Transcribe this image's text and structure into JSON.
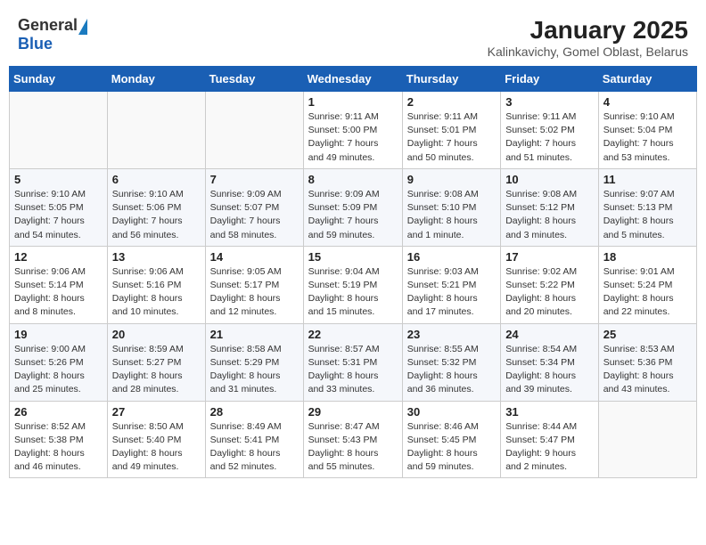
{
  "header": {
    "logo_general": "General",
    "logo_blue": "Blue",
    "title": "January 2025",
    "subtitle": "Kalinkavichy, Gomel Oblast, Belarus"
  },
  "weekdays": [
    "Sunday",
    "Monday",
    "Tuesday",
    "Wednesday",
    "Thursday",
    "Friday",
    "Saturday"
  ],
  "weeks": [
    [
      {
        "day": "",
        "info": ""
      },
      {
        "day": "",
        "info": ""
      },
      {
        "day": "",
        "info": ""
      },
      {
        "day": "1",
        "info": "Sunrise: 9:11 AM\nSunset: 5:00 PM\nDaylight: 7 hours\nand 49 minutes."
      },
      {
        "day": "2",
        "info": "Sunrise: 9:11 AM\nSunset: 5:01 PM\nDaylight: 7 hours\nand 50 minutes."
      },
      {
        "day": "3",
        "info": "Sunrise: 9:11 AM\nSunset: 5:02 PM\nDaylight: 7 hours\nand 51 minutes."
      },
      {
        "day": "4",
        "info": "Sunrise: 9:10 AM\nSunset: 5:04 PM\nDaylight: 7 hours\nand 53 minutes."
      }
    ],
    [
      {
        "day": "5",
        "info": "Sunrise: 9:10 AM\nSunset: 5:05 PM\nDaylight: 7 hours\nand 54 minutes."
      },
      {
        "day": "6",
        "info": "Sunrise: 9:10 AM\nSunset: 5:06 PM\nDaylight: 7 hours\nand 56 minutes."
      },
      {
        "day": "7",
        "info": "Sunrise: 9:09 AM\nSunset: 5:07 PM\nDaylight: 7 hours\nand 58 minutes."
      },
      {
        "day": "8",
        "info": "Sunrise: 9:09 AM\nSunset: 5:09 PM\nDaylight: 7 hours\nand 59 minutes."
      },
      {
        "day": "9",
        "info": "Sunrise: 9:08 AM\nSunset: 5:10 PM\nDaylight: 8 hours\nand 1 minute."
      },
      {
        "day": "10",
        "info": "Sunrise: 9:08 AM\nSunset: 5:12 PM\nDaylight: 8 hours\nand 3 minutes."
      },
      {
        "day": "11",
        "info": "Sunrise: 9:07 AM\nSunset: 5:13 PM\nDaylight: 8 hours\nand 5 minutes."
      }
    ],
    [
      {
        "day": "12",
        "info": "Sunrise: 9:06 AM\nSunset: 5:14 PM\nDaylight: 8 hours\nand 8 minutes."
      },
      {
        "day": "13",
        "info": "Sunrise: 9:06 AM\nSunset: 5:16 PM\nDaylight: 8 hours\nand 10 minutes."
      },
      {
        "day": "14",
        "info": "Sunrise: 9:05 AM\nSunset: 5:17 PM\nDaylight: 8 hours\nand 12 minutes."
      },
      {
        "day": "15",
        "info": "Sunrise: 9:04 AM\nSunset: 5:19 PM\nDaylight: 8 hours\nand 15 minutes."
      },
      {
        "day": "16",
        "info": "Sunrise: 9:03 AM\nSunset: 5:21 PM\nDaylight: 8 hours\nand 17 minutes."
      },
      {
        "day": "17",
        "info": "Sunrise: 9:02 AM\nSunset: 5:22 PM\nDaylight: 8 hours\nand 20 minutes."
      },
      {
        "day": "18",
        "info": "Sunrise: 9:01 AM\nSunset: 5:24 PM\nDaylight: 8 hours\nand 22 minutes."
      }
    ],
    [
      {
        "day": "19",
        "info": "Sunrise: 9:00 AM\nSunset: 5:26 PM\nDaylight: 8 hours\nand 25 minutes."
      },
      {
        "day": "20",
        "info": "Sunrise: 8:59 AM\nSunset: 5:27 PM\nDaylight: 8 hours\nand 28 minutes."
      },
      {
        "day": "21",
        "info": "Sunrise: 8:58 AM\nSunset: 5:29 PM\nDaylight: 8 hours\nand 31 minutes."
      },
      {
        "day": "22",
        "info": "Sunrise: 8:57 AM\nSunset: 5:31 PM\nDaylight: 8 hours\nand 33 minutes."
      },
      {
        "day": "23",
        "info": "Sunrise: 8:55 AM\nSunset: 5:32 PM\nDaylight: 8 hours\nand 36 minutes."
      },
      {
        "day": "24",
        "info": "Sunrise: 8:54 AM\nSunset: 5:34 PM\nDaylight: 8 hours\nand 39 minutes."
      },
      {
        "day": "25",
        "info": "Sunrise: 8:53 AM\nSunset: 5:36 PM\nDaylight: 8 hours\nand 43 minutes."
      }
    ],
    [
      {
        "day": "26",
        "info": "Sunrise: 8:52 AM\nSunset: 5:38 PM\nDaylight: 8 hours\nand 46 minutes."
      },
      {
        "day": "27",
        "info": "Sunrise: 8:50 AM\nSunset: 5:40 PM\nDaylight: 8 hours\nand 49 minutes."
      },
      {
        "day": "28",
        "info": "Sunrise: 8:49 AM\nSunset: 5:41 PM\nDaylight: 8 hours\nand 52 minutes."
      },
      {
        "day": "29",
        "info": "Sunrise: 8:47 AM\nSunset: 5:43 PM\nDaylight: 8 hours\nand 55 minutes."
      },
      {
        "day": "30",
        "info": "Sunrise: 8:46 AM\nSunset: 5:45 PM\nDaylight: 8 hours\nand 59 minutes."
      },
      {
        "day": "31",
        "info": "Sunrise: 8:44 AM\nSunset: 5:47 PM\nDaylight: 9 hours\nand 2 minutes."
      },
      {
        "day": "",
        "info": ""
      }
    ]
  ]
}
